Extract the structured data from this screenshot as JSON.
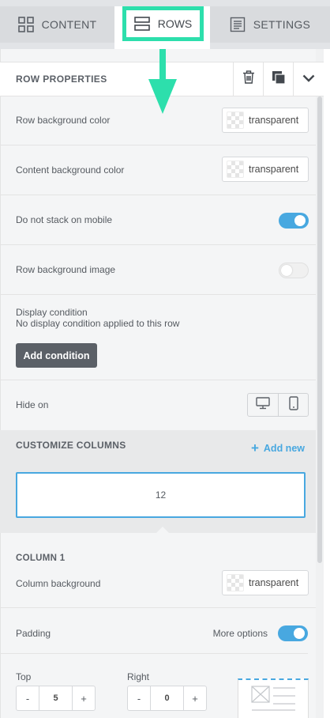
{
  "tabs": [
    {
      "label": "CONTENT",
      "icon": "grid-icon"
    },
    {
      "label": "ROWS",
      "icon": "rows-icon"
    },
    {
      "label": "SETTINGS",
      "icon": "document-icon"
    }
  ],
  "row_properties": {
    "title": "ROW PROPERTIES",
    "actions": [
      "trash-icon",
      "duplicate-icon",
      "chevron-down-icon"
    ]
  },
  "fields": {
    "row_bg": {
      "label": "Row background color",
      "value": "transparent"
    },
    "content_bg": {
      "label": "Content background color",
      "value": "transparent"
    },
    "no_stack": {
      "label": "Do not stack on mobile",
      "on": true
    },
    "row_bg_image": {
      "label": "Row background image",
      "on": false
    },
    "display_condition": {
      "label": "Display condition",
      "sublabel": "No display condition applied to this row",
      "button": "Add condition"
    },
    "hide_on": {
      "label": "Hide on",
      "devices": [
        "desktop-icon",
        "mobile-icon"
      ]
    }
  },
  "customize_columns": {
    "title": "CUSTOMIZE COLUMNS",
    "add_new": "Add new",
    "columns": [
      "12"
    ]
  },
  "column": {
    "title": "COLUMN 1",
    "background": {
      "label": "Column background",
      "value": "transparent"
    },
    "padding": {
      "label": "Padding",
      "more_options": "More options",
      "more_options_on": true,
      "top": {
        "label": "Top",
        "value": "5"
      },
      "right": {
        "label": "Right",
        "value": "0"
      }
    }
  },
  "colors": {
    "accent": "#48a8e0",
    "highlight": "#2ddfac",
    "dark_button": "#5b6067"
  }
}
